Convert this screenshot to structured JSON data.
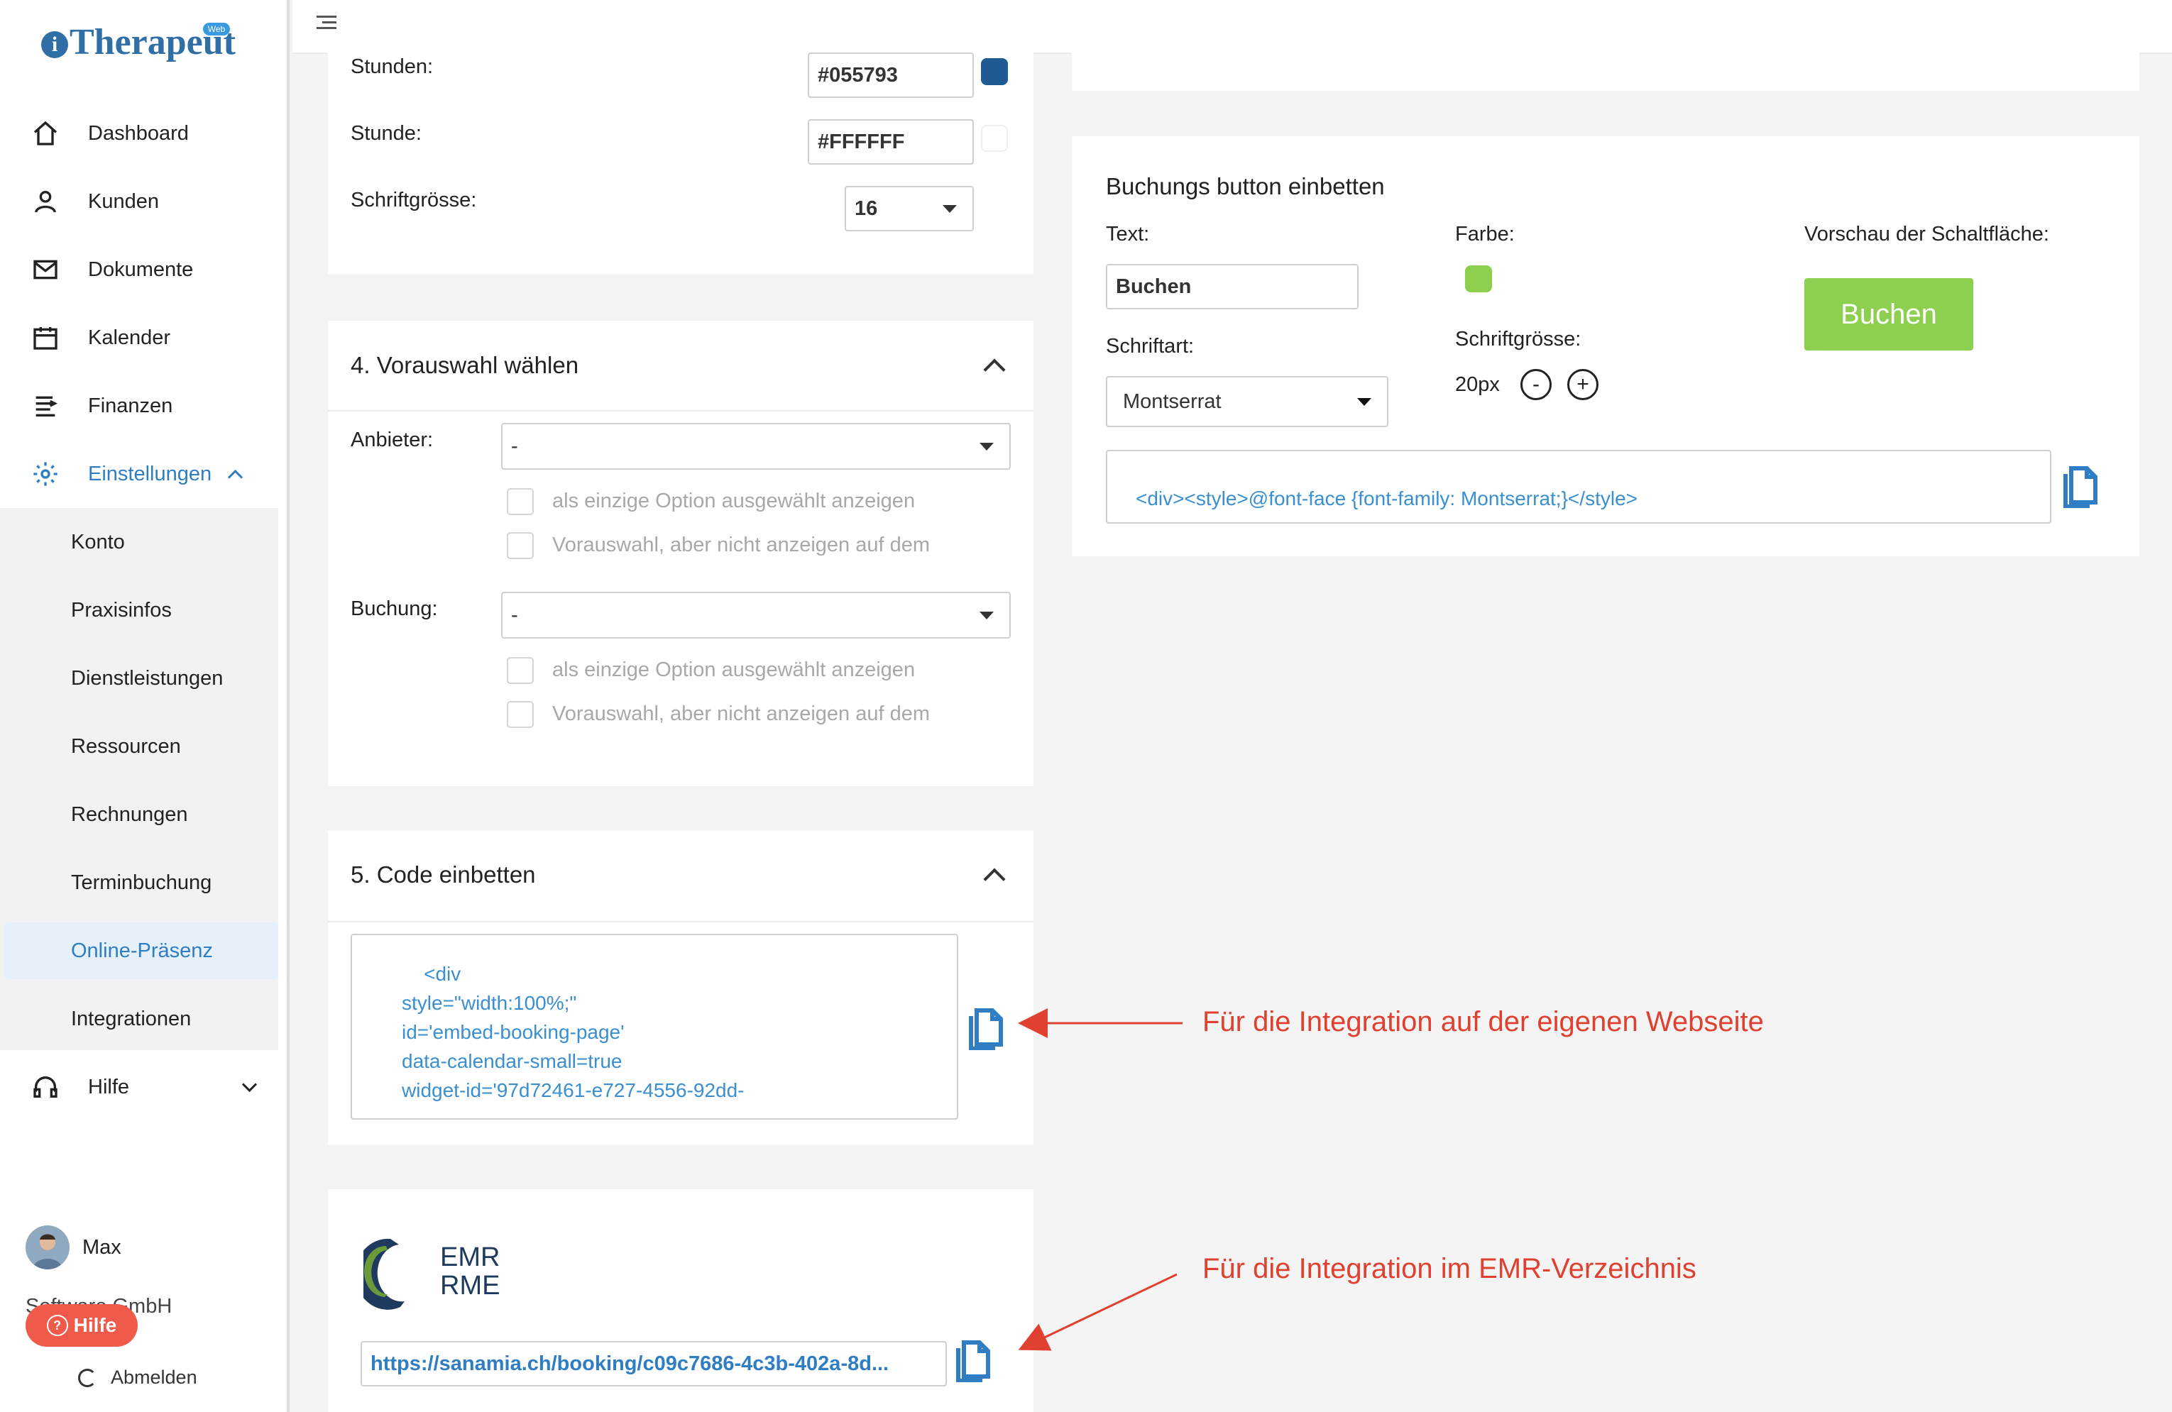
{
  "app": {
    "logo_text": "Therapeut",
    "logo_badge": "Web"
  },
  "sidebar": {
    "nav": [
      {
        "label": "Dashboard",
        "icon": "home-icon"
      },
      {
        "label": "Kunden",
        "icon": "users-icon"
      },
      {
        "label": "Dokumente",
        "icon": "mail-icon"
      },
      {
        "label": "Kalender",
        "icon": "calendar-icon"
      },
      {
        "label": "Finanzen",
        "icon": "finance-icon"
      },
      {
        "label": "Einstellungen",
        "icon": "gear-icon"
      }
    ],
    "sub": [
      "Konto",
      "Praxisinfos",
      "Dienstleistungen",
      "Ressourcen",
      "Rechnungen",
      "Terminbuchung",
      "Online-Präsenz",
      "Integrationen"
    ],
    "help": "Hilfe",
    "user_name": "Max",
    "company": "Software GmbH",
    "help_button": "Hilfe",
    "logout": "Abmelden"
  },
  "colors_section": {
    "stunden_label": "Stunden:",
    "stunden_value": "#055793",
    "stunden_color": "#1f5a93",
    "stunde_label": "Stunde:",
    "stunde_value": "#FFFFFF",
    "stunde_color": "#FFFFFF",
    "font_size_label": "Schriftgrösse:",
    "font_size_value": "16"
  },
  "preselect": {
    "title": "4. Vorauswahl wählen",
    "anbieter_label": "Anbieter:",
    "anbieter_value": "-",
    "buchung_label": "Buchung:",
    "buchung_value": "-",
    "opt_only": "als einzige Option ausgewählt anzeigen",
    "opt_hidden": "Vorauswahl, aber nicht anzeigen auf dem"
  },
  "embed": {
    "title": "5. Code einbetten",
    "code": "    <div\nstyle=\"width:100%;\"\nid='embed-booking-page'\ndata-calendar-small=true\nwidget-id='97d72461-e727-4556-92dd-"
  },
  "emr": {
    "logo_line1": "EMR",
    "logo_line2": "RME",
    "url": "https://sanamia.ch/booking/c09c7686-4c3b-402a-8d..."
  },
  "button_embed": {
    "title": "Buchungs button einbetten",
    "text_label": "Text:",
    "text_value": "Buchen",
    "color_label": "Farbe:",
    "color": "#8dcf4f",
    "preview_label": "Vorschau der Schaltfläche:",
    "preview_button": "Buchen",
    "font_label": "Schriftart:",
    "font_value": "Montserrat",
    "size_label": "Schriftgrösse:",
    "size_value": "20px",
    "minus": "-",
    "plus": "+",
    "code": "<div><style>@font-face {font-family: Montserrat;}</style>"
  },
  "annotations": {
    "website": "Für die Integration auf der eigenen Webseite",
    "emr": "Für die Integration im EMR-Verzeichnis"
  }
}
